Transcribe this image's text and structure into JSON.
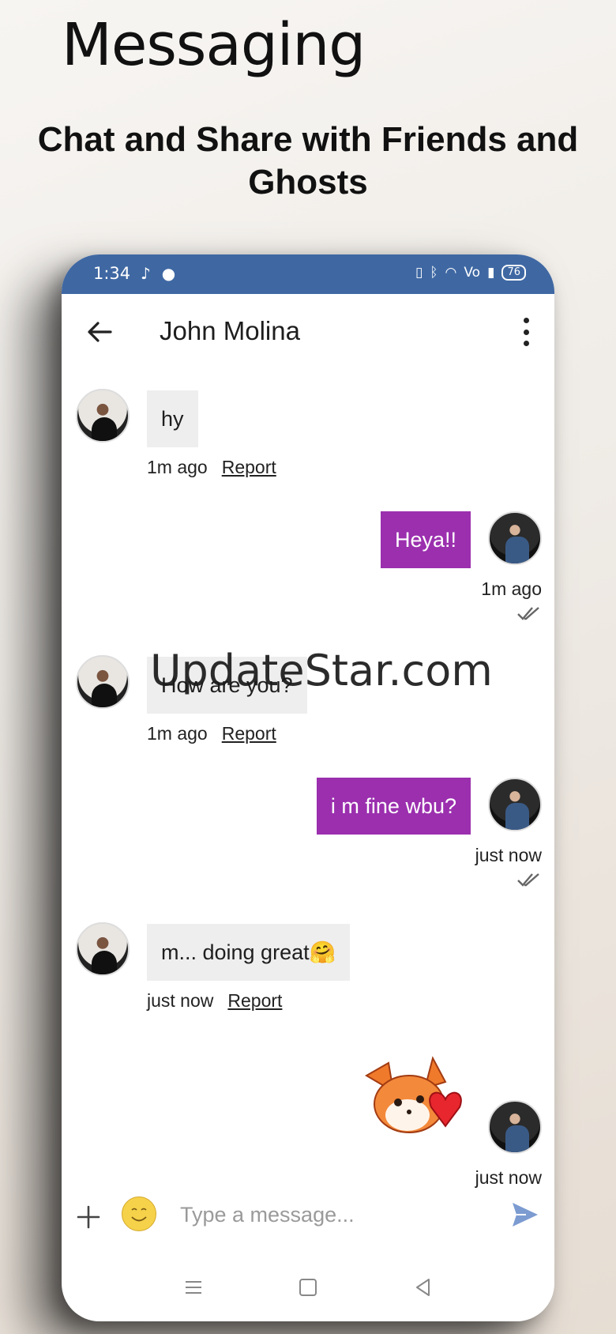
{
  "promo": {
    "title": "Messaging",
    "subtitle": "Chat and Share with Friends and Ghosts"
  },
  "status_bar": {
    "time": "1:34",
    "battery": "76"
  },
  "chat": {
    "contact_name": "John Molina",
    "messages": [
      {
        "side": "in",
        "text": "hy",
        "time": "1m ago",
        "report": "Report"
      },
      {
        "side": "out",
        "text": "Heya!!",
        "time": "1m ago"
      },
      {
        "side": "in",
        "text": "How are you?",
        "time": "1m ago",
        "report": "Report"
      },
      {
        "side": "out",
        "text": "i m fine wbu?",
        "time": "just now"
      },
      {
        "side": "in",
        "text": "m... doing great🤗",
        "time": "just now",
        "report": "Report"
      },
      {
        "side": "out",
        "sticker": "fox-heart-sticker",
        "time": "just now"
      }
    ]
  },
  "composer": {
    "placeholder": "Type a message..."
  },
  "watermark": "UpdateStar.com",
  "colors": {
    "status_bar": "#3f68a3",
    "outgoing_bubble": "#9b2fae",
    "incoming_bubble": "#eeeeee",
    "send_icon": "#7c9bd1"
  },
  "icons": [
    "back-arrow-icon",
    "more-vert-icon",
    "plus-icon",
    "emoji-icon",
    "send-icon",
    "double-check-icon",
    "nav-menu-icon",
    "nav-home-icon",
    "nav-back-icon"
  ]
}
